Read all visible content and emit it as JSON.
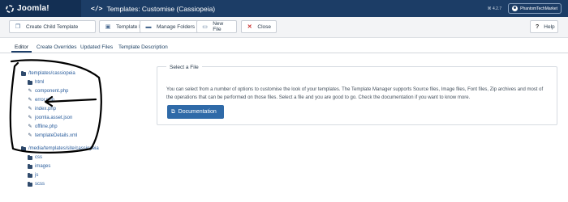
{
  "header": {
    "brand": "Joomla!",
    "title": "Templates: Customise (Cassiopeia)",
    "version": "⌘ 4.2.7",
    "user": "PhantomTechMarket"
  },
  "toolbar": {
    "create_child": "Create Child Template",
    "preview": "Template Preview",
    "manage_folders": "Manage Folders",
    "new_file": "New File",
    "close": "Close",
    "help": "Help"
  },
  "tabs": [
    "Editor",
    "Create Overrides",
    "Updated Files",
    "Template Description"
  ],
  "tree": {
    "root1": "/templates/cassiopeia",
    "root1_items": [
      {
        "type": "folder",
        "name": "html"
      },
      {
        "type": "file",
        "name": "component.php"
      },
      {
        "type": "file",
        "name": "error.php"
      },
      {
        "type": "file",
        "name": "index.php"
      },
      {
        "type": "file",
        "name": "joomla.asset.json"
      },
      {
        "type": "file",
        "name": "offline.php"
      },
      {
        "type": "file",
        "name": "templateDetails.xml"
      }
    ],
    "root2": "/media/templates/site/cassiopeia",
    "root2_items": [
      {
        "type": "folder",
        "name": "css"
      },
      {
        "type": "folder",
        "name": "images"
      },
      {
        "type": "folder",
        "name": "js"
      },
      {
        "type": "folder",
        "name": "scss"
      }
    ]
  },
  "panel": {
    "legend": "Select a File",
    "description": "You can select from a number of options to customise the look of your templates. The Template Manager supports Source files, Image files, Font files, Zip archives and most of the operations that can be performed on those files. Select a file and you are good to go. Check the documentation if you want to know more.",
    "doc_button": "Documentation"
  },
  "colors": {
    "brand_bg": "#132f53",
    "header_bg": "#1c3d66",
    "link": "#2a5d9c",
    "primary_button": "#2f6aa8",
    "close_icon": "#c52827"
  },
  "icons": {
    "create_child": "copy-icon",
    "preview": "image-icon",
    "manage_folders": "folder-icon",
    "new_file": "file-icon",
    "close": "close-icon",
    "help": "question-icon",
    "doc_button": "external-link-icon"
  }
}
